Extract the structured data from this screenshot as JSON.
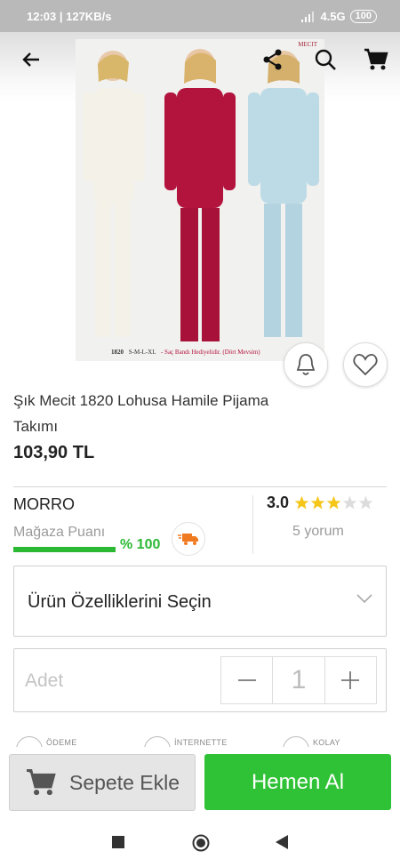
{
  "status_bar": {
    "time_speed": "12:03 | 127KB/s",
    "network": "4.5G",
    "battery": "100"
  },
  "product": {
    "image_caption": "1820",
    "image_caption_sizes": "S-M-L-XL",
    "image_caption_note": "- Saç Bandı Hediyelidir. (Dört Mevsim)",
    "brand_logo": "MECIT",
    "title_line1": "Şık Mecit 1820 Lohusa Hamile Pijama",
    "title_line2": "Takımı",
    "price": "103,90 TL"
  },
  "seller": {
    "name": "MORRO",
    "score_label": "Mağaza Puanı",
    "score_value": "% 100",
    "score_fraction": 1.0
  },
  "rating": {
    "score": "3.0",
    "stars_filled": 3,
    "stars_total": 5,
    "reviews": "5 yorum"
  },
  "options": {
    "select_label": "Ürün Özelliklerini Seçin"
  },
  "quantity": {
    "label": "Adet",
    "value": "1"
  },
  "peek_labels": [
    "ÖDEME",
    "İNTERNETTE",
    "KOLAY"
  ],
  "actions": {
    "add_to_cart": "Sepete Ekle",
    "buy_now": "Hemen Al"
  },
  "colors": {
    "accent_green": "#30c236",
    "star_gold": "#f5c518",
    "outfit_white": "#f4f1e8",
    "outfit_red": "#b3143e",
    "outfit_blue": "#bcdbe6"
  },
  "icons": [
    "back-arrow-icon",
    "share-icon",
    "search-icon",
    "cart-icon",
    "bell-icon",
    "heart-icon",
    "truck-icon",
    "chevron-down-icon",
    "minus-icon",
    "plus-icon",
    "nav-square-icon",
    "nav-circle-icon",
    "nav-back-triangle-icon"
  ]
}
